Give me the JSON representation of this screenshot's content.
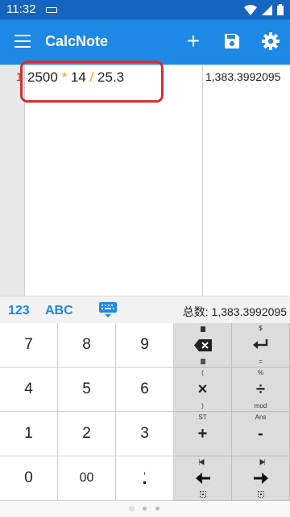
{
  "status": {
    "time": "11:32"
  },
  "app": {
    "title": "CalcNote"
  },
  "editor": {
    "line_number": "1",
    "tokens": [
      "2500",
      "*",
      "14",
      "/",
      "25.3"
    ],
    "result": "1,383.3992095"
  },
  "keyboard_bar": {
    "mode_123": "123",
    "mode_abc": "ABC",
    "total": "总数: 1,383.3992095"
  },
  "keys": {
    "k7": "7",
    "k8": "8",
    "k9": "9",
    "k4": "4",
    "k5": "5",
    "k6": "6",
    "k1": "1",
    "k2": "2",
    "k3": "3",
    "k0": "0",
    "k00": "00",
    "kdot": ".",
    "kcomma": ",",
    "dollar": "$",
    "eq": "=",
    "lparen": "(",
    "rparen": ")",
    "percent": "%",
    "mod": "mod",
    "st": "ST",
    "ans": "Ans",
    "times": "×",
    "div": "÷",
    "plus": "+",
    "minus": "-"
  },
  "colors": {
    "app_bar": "#1e88e5",
    "status_bar": "#1565c0",
    "operator": "#f39c12",
    "line_number": "#d32f2f",
    "highlight": "#d32f2f"
  }
}
